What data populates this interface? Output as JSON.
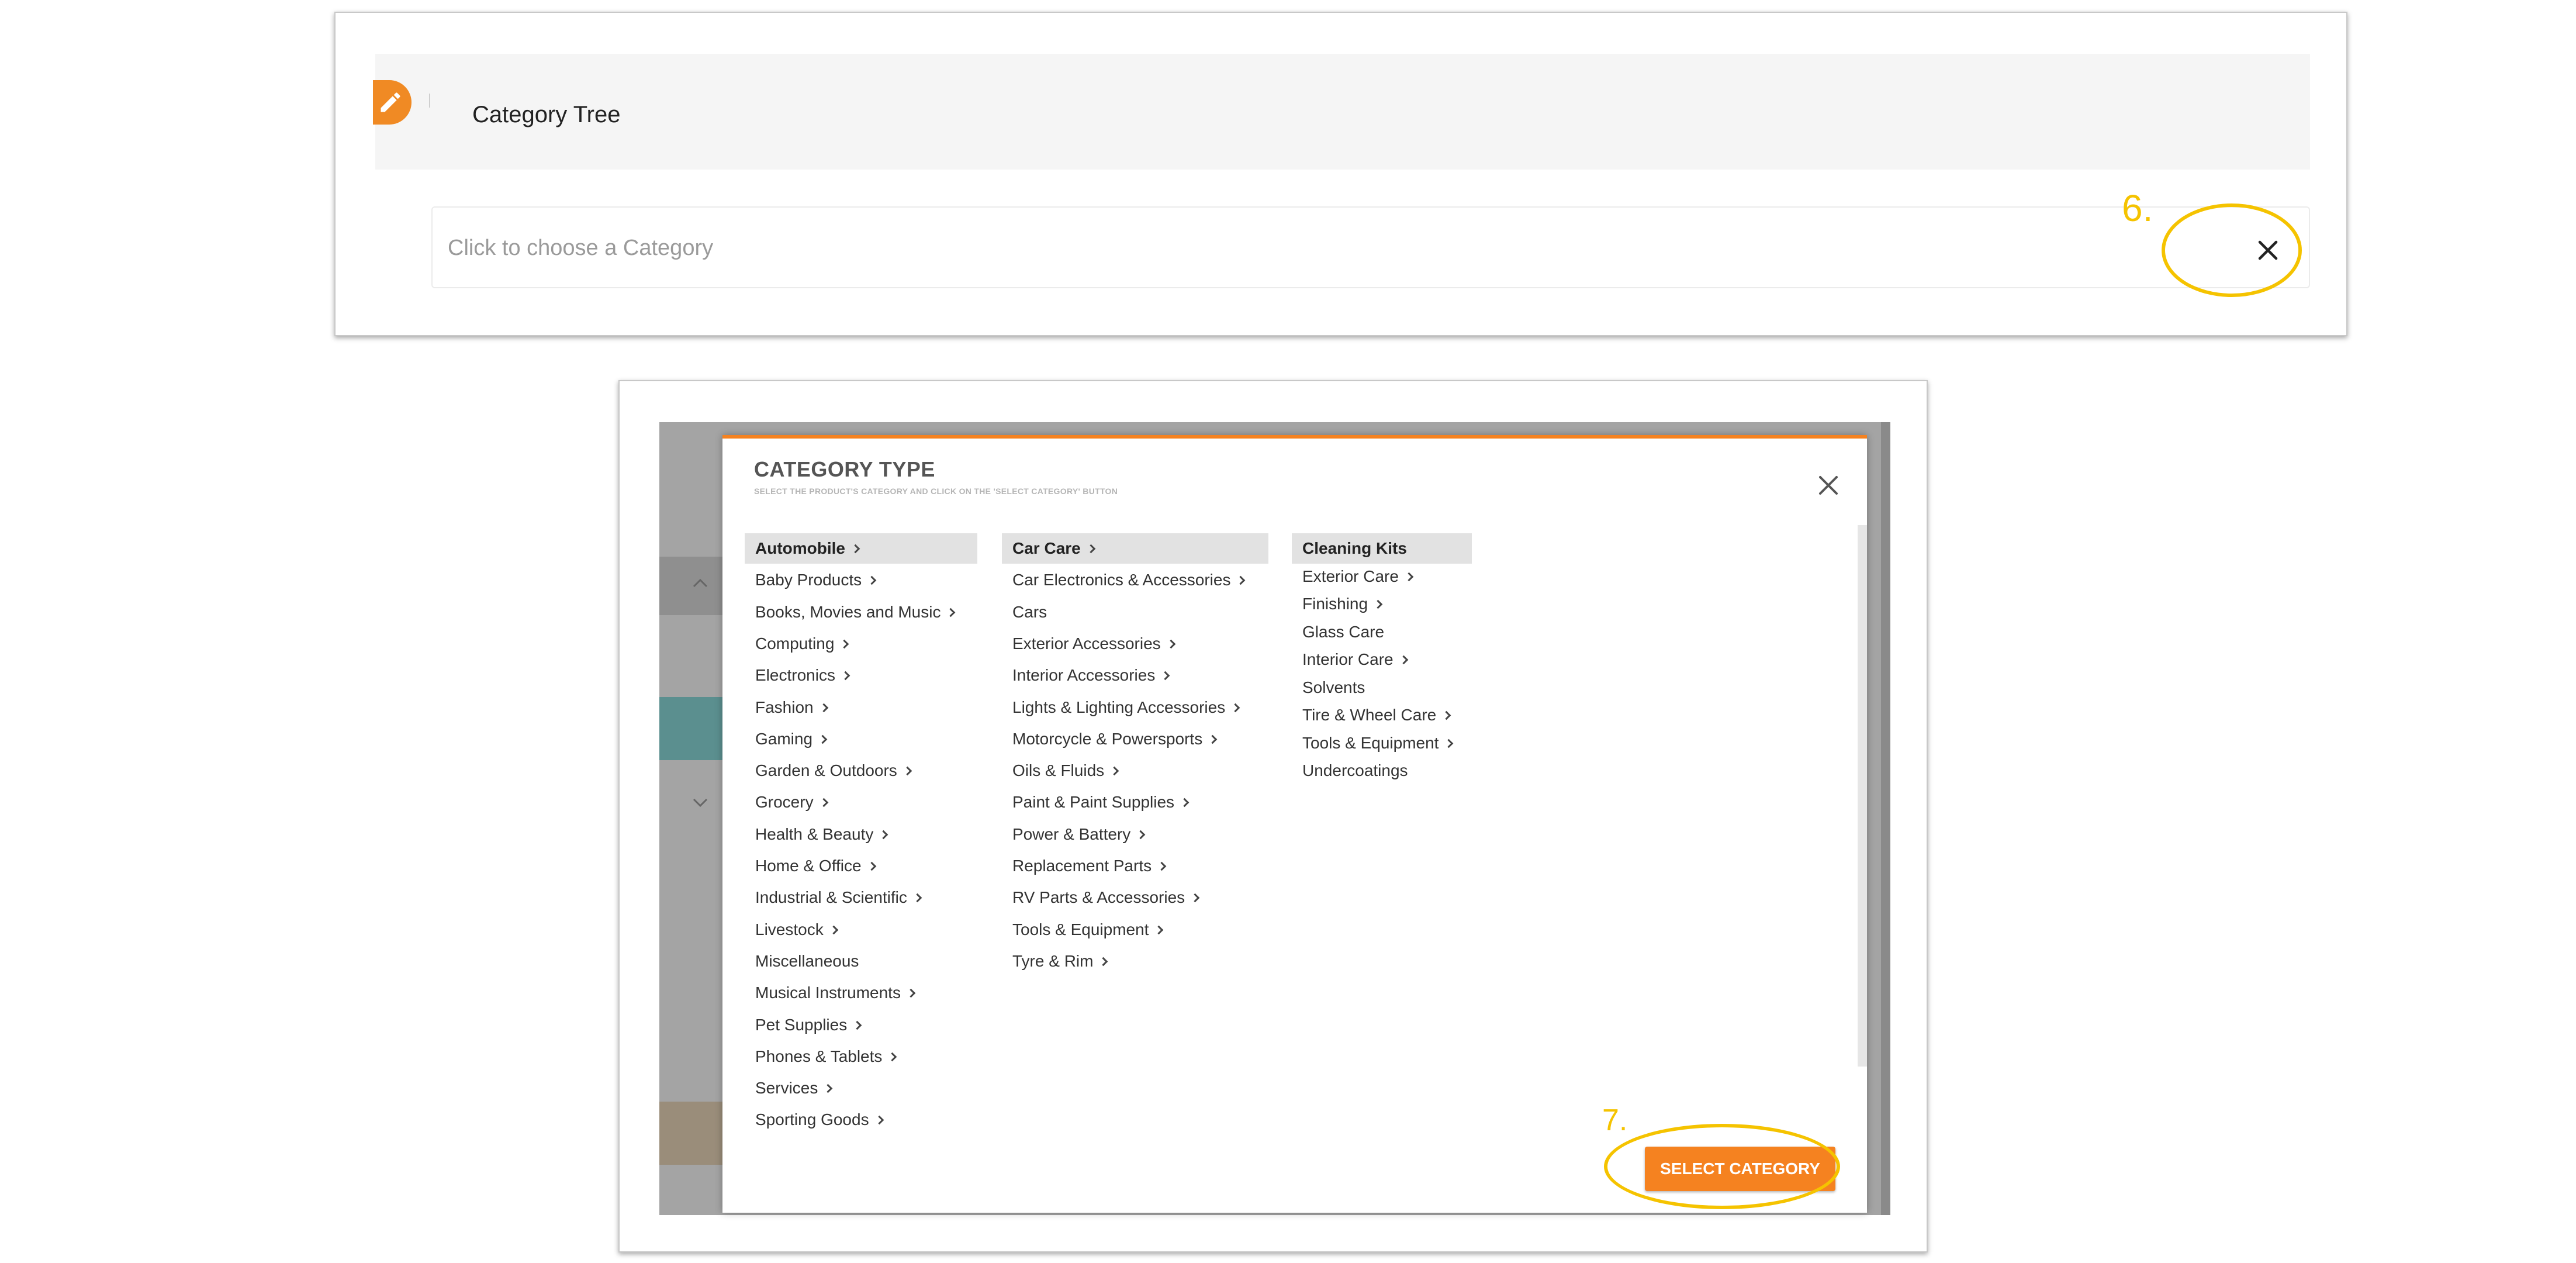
{
  "category_tree": {
    "title": "Category Tree",
    "input_placeholder": "Click to choose a Category"
  },
  "annotations": {
    "step6": "6.",
    "step7": "7."
  },
  "modal": {
    "title": "CATEGORY TYPE",
    "subtitle": "SELECT THE PRODUCT'S CATEGORY AND CLICK ON THE 'SELECT CATEGORY' BUTTON",
    "select_button": "SELECT CATEGORY",
    "column1": [
      {
        "label": "Automobile",
        "chevron": true,
        "selected": true
      },
      {
        "label": "Baby Products",
        "chevron": true
      },
      {
        "label": "Books, Movies and Music",
        "chevron": true
      },
      {
        "label": "Computing",
        "chevron": true
      },
      {
        "label": "Electronics",
        "chevron": true
      },
      {
        "label": "Fashion",
        "chevron": true
      },
      {
        "label": "Gaming",
        "chevron": true
      },
      {
        "label": "Garden & Outdoors",
        "chevron": true
      },
      {
        "label": "Grocery",
        "chevron": true
      },
      {
        "label": "Health & Beauty",
        "chevron": true
      },
      {
        "label": "Home & Office",
        "chevron": true
      },
      {
        "label": "Industrial & Scientific",
        "chevron": true
      },
      {
        "label": "Livestock",
        "chevron": true
      },
      {
        "label": "Miscellaneous",
        "chevron": false
      },
      {
        "label": "Musical Instruments",
        "chevron": true
      },
      {
        "label": "Pet Supplies",
        "chevron": true
      },
      {
        "label": "Phones & Tablets",
        "chevron": true
      },
      {
        "label": "Services",
        "chevron": true
      },
      {
        "label": "Sporting Goods",
        "chevron": true
      }
    ],
    "column2": [
      {
        "label": "Car Care",
        "chevron": true,
        "selected": true
      },
      {
        "label": "Car Electronics & Accessories",
        "chevron": true
      },
      {
        "label": "Cars",
        "chevron": false
      },
      {
        "label": "Exterior Accessories",
        "chevron": true
      },
      {
        "label": "Interior Accessories",
        "chevron": true
      },
      {
        "label": "Lights & Lighting Accessories",
        "chevron": true
      },
      {
        "label": "Motorcycle & Powersports",
        "chevron": true
      },
      {
        "label": "Oils & Fluids",
        "chevron": true
      },
      {
        "label": "Paint & Paint Supplies",
        "chevron": true
      },
      {
        "label": "Power & Battery",
        "chevron": true
      },
      {
        "label": "Replacement Parts",
        "chevron": true
      },
      {
        "label": "RV Parts & Accessories",
        "chevron": true
      },
      {
        "label": "Tools & Equipment",
        "chevron": true
      },
      {
        "label": "Tyre & Rim",
        "chevron": true
      }
    ],
    "column3": [
      {
        "label": "Cleaning Kits",
        "chevron": false,
        "selected": true
      },
      {
        "label": "Exterior Care",
        "chevron": true
      },
      {
        "label": "Finishing",
        "chevron": true
      },
      {
        "label": "Glass Care",
        "chevron": false
      },
      {
        "label": "Interior Care",
        "chevron": true
      },
      {
        "label": "Solvents",
        "chevron": false
      },
      {
        "label": "Tire & Wheel Care",
        "chevron": true
      },
      {
        "label": "Tools & Equipment",
        "chevron": true
      },
      {
        "label": "Undercoatings",
        "chevron": false
      }
    ]
  },
  "colors": {
    "accent": "#f58220",
    "annotation": "#f5c300"
  }
}
